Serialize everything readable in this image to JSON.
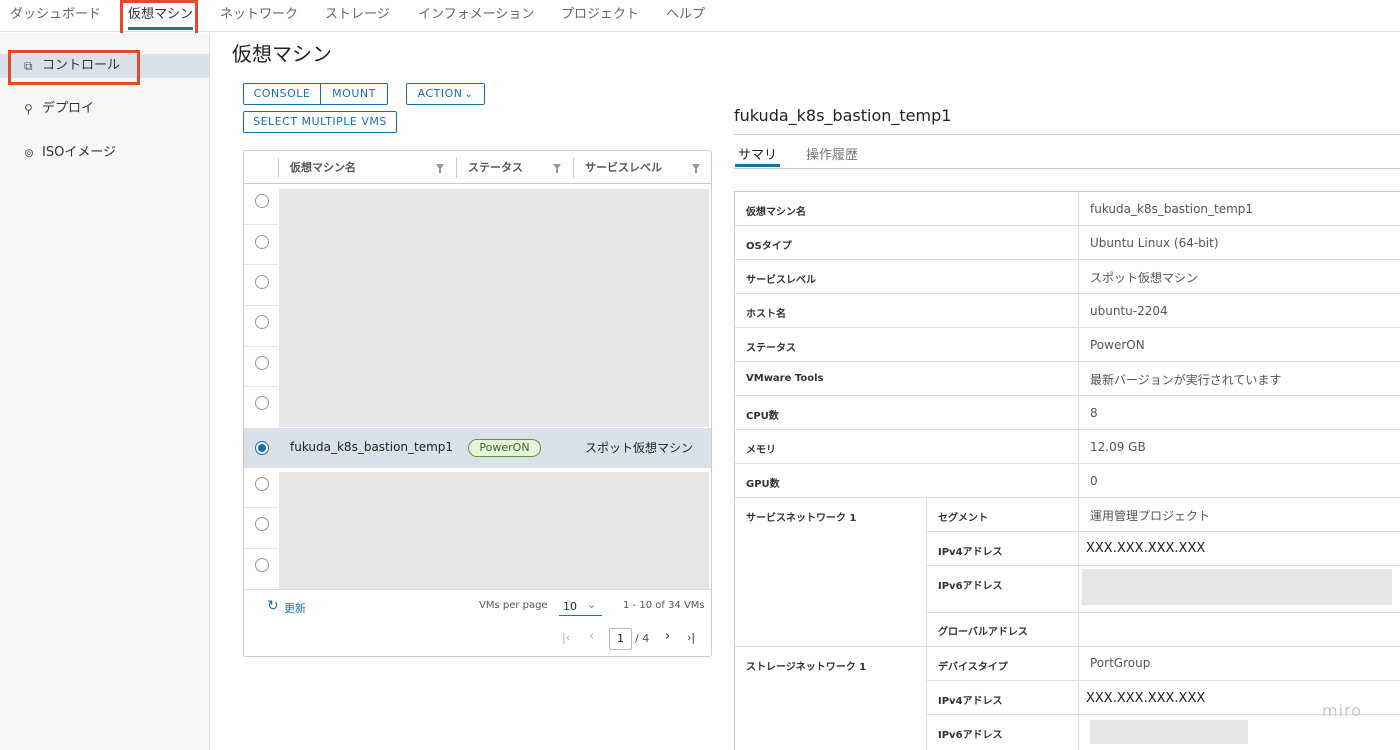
{
  "nav": {
    "tabs": [
      "ダッシュボード",
      "仮想マシン",
      "ネットワーク",
      "ストレージ",
      "インフォメーション",
      "プロジェクト",
      "ヘルプ"
    ],
    "active_tab": "仮想マシン"
  },
  "sidebar": {
    "items": [
      {
        "label": "コントロール",
        "icon": "copy-icon"
      },
      {
        "label": "デプロイ",
        "icon": "deploy-icon"
      },
      {
        "label": "ISOイメージ",
        "icon": "disc-icon"
      }
    ]
  },
  "page": {
    "title": "仮想マシン"
  },
  "toolbar": {
    "console": "CONSOLE",
    "mount": "MOUNT",
    "action": "ACTION",
    "action_caret": "⌄",
    "select_multiple": "SELECT MULTIPLE VMS"
  },
  "grid": {
    "columns": [
      "仮想マシン名",
      "ステータス",
      "サービスレベル"
    ],
    "selected_row": {
      "name": "fukuda_k8s_bastion_temp1",
      "status": "PowerON",
      "service_level": "スポット仮想マシン"
    },
    "footer": {
      "refresh": "更新",
      "refresh_icon": "↻",
      "per_page_label": "VMs per page",
      "per_page_value": "10",
      "per_page_caret": "⌄",
      "range": "1 - 10 of 34 VMs",
      "page_current": "1",
      "page_total": "/ 4",
      "first": "|‹",
      "prev": "‹",
      "next": "›",
      "last": "›|"
    }
  },
  "detail": {
    "title": "fukuda_k8s_bastion_temp1",
    "tabs": [
      "サマリ",
      "操作履歴"
    ],
    "rows": [
      {
        "key": "仮想マシン名",
        "value": "fukuda_k8s_bastion_temp1"
      },
      {
        "key": "OSタイプ",
        "value": "Ubuntu Linux (64-bit)"
      },
      {
        "key": "サービスレベル",
        "value": "スポット仮想マシン"
      },
      {
        "key": "ホスト名",
        "value": "ubuntu-2204"
      },
      {
        "key": "ステータス",
        "value": "PowerON"
      },
      {
        "key": "VMware Tools",
        "value": "最新バージョンが実行されています"
      },
      {
        "key": "CPU数",
        "value": "8"
      },
      {
        "key": "メモリ",
        "value": "12.09 GB"
      },
      {
        "key": "GPU数",
        "value": "0"
      }
    ],
    "service_network": {
      "label": "サービスネットワーク 1",
      "rows": [
        {
          "key": "セグメント",
          "value": "運用管理プロジェクト"
        },
        {
          "key": "IPv4アドレス",
          "value": "XXX.XXX.XXX.XXX"
        },
        {
          "key": "IPv6アドレス",
          "value": ""
        },
        {
          "key": "グローバルアドレス",
          "value": ""
        }
      ]
    },
    "storage_network": {
      "label": "ストレージネットワーク 1",
      "rows": [
        {
          "key": "デバイスタイプ",
          "value": "PortGroup"
        },
        {
          "key": "IPv4アドレス",
          "value": "XXX.XXX.XXX.XXX"
        },
        {
          "key": "IPv6アドレス",
          "value": ""
        }
      ]
    }
  },
  "watermark": "miro",
  "colors": {
    "accent": "#1b6fa8",
    "highlight": "#e04a2f",
    "badge_green": "#5a9a3a"
  }
}
